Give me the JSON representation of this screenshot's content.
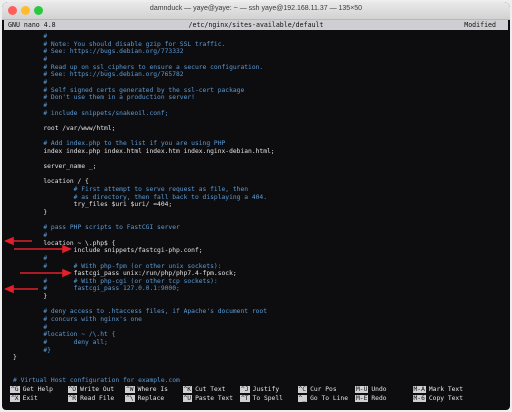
{
  "window": {
    "title": "damnduck — yaye@yaye: ~ — ssh yaye@192.168.11.37 — 135×50"
  },
  "nano": {
    "version": "GNU nano 4.8",
    "filename": "/etc/nginx/sites-available/default",
    "status": "Modified"
  },
  "lines": [
    {
      "text": "        #",
      "type": "comment"
    },
    {
      "text": "        # Note: You should disable gzip for SSL traffic.",
      "type": "comment"
    },
    {
      "text": "        # See: https://bugs.debian.org/773332",
      "type": "comment"
    },
    {
      "text": "        #",
      "type": "comment"
    },
    {
      "text": "        # Read up on ssl_ciphers to ensure a secure configuration.",
      "type": "comment"
    },
    {
      "text": "        # See: https://bugs.debian.org/765782",
      "type": "comment"
    },
    {
      "text": "        #",
      "type": "comment"
    },
    {
      "text": "        # Self signed certs generated by the ssl-cert package",
      "type": "comment"
    },
    {
      "text": "        # Don't use them in a production server!",
      "type": "comment"
    },
    {
      "text": "        #",
      "type": "comment"
    },
    {
      "text": "        # include snippets/snakeoil.conf;",
      "type": "comment"
    },
    {
      "text": "",
      "type": "code"
    },
    {
      "text": "        root /var/www/html;",
      "type": "code"
    },
    {
      "text": "",
      "type": "code"
    },
    {
      "text": "        # Add index.php to the list if you are using PHP",
      "type": "comment"
    },
    {
      "text": "        index index.php index.html index.htm index.nginx-debian.html;",
      "type": "code"
    },
    {
      "text": "",
      "type": "code"
    },
    {
      "text": "        server_name _;",
      "type": "code"
    },
    {
      "text": "",
      "type": "code"
    },
    {
      "text": "        location / {",
      "type": "code"
    },
    {
      "text": "                # First attempt to serve request as file, then",
      "type": "comment"
    },
    {
      "text": "                # as directory, then fall back to displaying a 404.",
      "type": "comment"
    },
    {
      "text": "                try_files $uri $uri/ =404;",
      "type": "code"
    },
    {
      "text": "        }",
      "type": "code"
    },
    {
      "text": "",
      "type": "code"
    },
    {
      "text": "        # pass PHP scripts to FastCGI server",
      "type": "comment"
    },
    {
      "text": "        #",
      "type": "comment"
    },
    {
      "text": "        location ~ \\.php$ {",
      "type": "code"
    },
    {
      "text": "                include snippets/fastcgi-php.conf;",
      "type": "code"
    },
    {
      "text": "        #",
      "type": "comment"
    },
    {
      "text": "        #       # With php-fpm (or other unix sockets):",
      "type": "comment"
    },
    {
      "text": "                fastcgi_pass unix:/run/php/php7.4-fpm.sock;",
      "type": "code"
    },
    {
      "text": "        #       # With php-cgi (or other tcp sockets):",
      "type": "comment"
    },
    {
      "text": "        #       fastcgi_pass 127.0.0.1:9000;",
      "type": "comment"
    },
    {
      "text": "        }",
      "type": "code"
    },
    {
      "text": "",
      "type": "code"
    },
    {
      "text": "        # deny access to .htaccess files, if Apache's document root",
      "type": "comment"
    },
    {
      "text": "        # concurs with nginx's one",
      "type": "comment"
    },
    {
      "text": "        #",
      "type": "comment"
    },
    {
      "text": "        #location ~ /\\.ht {",
      "type": "comment"
    },
    {
      "text": "        #       deny all;",
      "type": "comment"
    },
    {
      "text": "        #}",
      "type": "comment"
    },
    {
      "text": "}",
      "type": "code"
    },
    {
      "text": "",
      "type": "code"
    },
    {
      "text": "",
      "type": "code"
    },
    {
      "text": "# Virtual Host configuration for example.com",
      "type": "comment"
    }
  ],
  "shortcuts": [
    {
      "key": "^G",
      "label": "Get Help"
    },
    {
      "key": "^O",
      "label": "Write Out"
    },
    {
      "key": "^W",
      "label": "Where Is"
    },
    {
      "key": "^K",
      "label": "Cut Text"
    },
    {
      "key": "^J",
      "label": "Justify"
    },
    {
      "key": "^C",
      "label": "Cur Pos"
    },
    {
      "key": "M-U",
      "label": "Undo"
    },
    {
      "key": "M-A",
      "label": "Mark Text"
    },
    {
      "key": "^X",
      "label": "Exit"
    },
    {
      "key": "^R",
      "label": "Read File"
    },
    {
      "key": "^\\",
      "label": "Replace"
    },
    {
      "key": "^U",
      "label": "Paste Text"
    },
    {
      "key": "^T",
      "label": "To Spell"
    },
    {
      "key": "^_",
      "label": "Go To Line"
    },
    {
      "key": "M-E",
      "label": "Redo"
    },
    {
      "key": "M-6",
      "label": "Copy Text"
    }
  ],
  "colors": {
    "background": "#0d0d10",
    "text": "#e4e4e4",
    "comment": "#5b9bd5",
    "header_bar": "#cfcfd3",
    "annotation": "#e0202a"
  }
}
